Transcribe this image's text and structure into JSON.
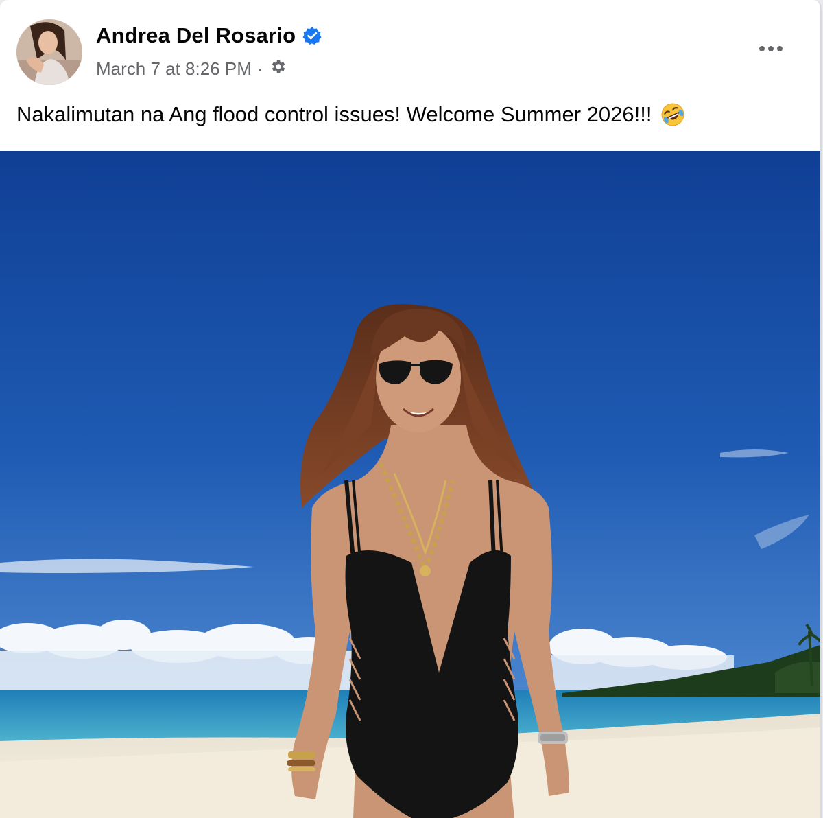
{
  "post": {
    "author_name": "Andrea Del Rosario",
    "timestamp": "March 7 at 8:26 PM",
    "separator": "·",
    "caption": "Nakalimutan na Ang flood control issues!  Welcome Summer 2026!!!",
    "verified": true,
    "caption_emoji": "rolling-on-floor-laughing",
    "privacy_icon": "gear-icon",
    "options_icon": "more-horizontal-icon"
  },
  "colors": {
    "verified_badge": "#1877f2",
    "meta_text": "#65676b",
    "sky": "#1f5ab0",
    "sea": "#2f9ccb",
    "sand": "#efe7d6",
    "swimsuit": "#141414"
  }
}
